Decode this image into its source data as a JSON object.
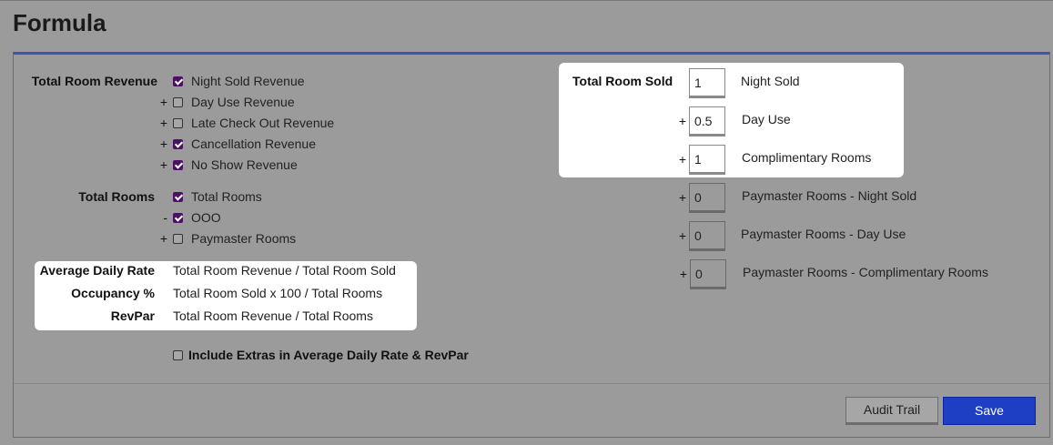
{
  "page_title": "Formula",
  "colors": {
    "accent": "#3856b4",
    "checkbox_checked": "#4b1263",
    "save_button": "#1e3fc4"
  },
  "total_room_revenue": {
    "label": "Total Room Revenue",
    "items": [
      {
        "op": "",
        "label": "Night Sold Revenue",
        "checked": true
      },
      {
        "op": "+",
        "label": "Day Use Revenue",
        "checked": false
      },
      {
        "op": "+",
        "label": "Late Check Out Revenue",
        "checked": false
      },
      {
        "op": "+",
        "label": "Cancellation Revenue",
        "checked": true
      },
      {
        "op": "+",
        "label": "No Show Revenue",
        "checked": true
      }
    ]
  },
  "total_rooms": {
    "label": "Total Rooms",
    "items": [
      {
        "op": "",
        "label": "Total Rooms",
        "checked": true
      },
      {
        "op": "-",
        "label": "OOO",
        "checked": true
      },
      {
        "op": "+",
        "label": "Paymaster Rooms",
        "checked": false
      }
    ]
  },
  "formulas": [
    {
      "label": "Average Daily Rate",
      "expression": "Total Room Revenue / Total Room Sold"
    },
    {
      "label": "Occupancy %",
      "expression": "Total Room Sold x 100 / Total Rooms"
    },
    {
      "label": "RevPar",
      "expression": "Total Room Revenue / Total Rooms"
    }
  ],
  "include_extras": {
    "label": "Include Extras in Average Daily Rate & RevPar",
    "checked": false
  },
  "total_room_sold": {
    "label": "Total Room Sold",
    "items": [
      {
        "op": "",
        "value": "1",
        "label": "Night Sold"
      },
      {
        "op": "+",
        "value": "0.5",
        "label": "Day Use"
      },
      {
        "op": "+",
        "value": "1",
        "label": "Complimentary Rooms"
      },
      {
        "op": "+",
        "value": "0",
        "label": "Paymaster Rooms - Night Sold"
      },
      {
        "op": "+",
        "value": "0",
        "label": "Paymaster Rooms - Day Use"
      },
      {
        "op": "+",
        "value": "0",
        "label": "Paymaster Rooms - Complimentary Rooms"
      }
    ]
  },
  "buttons": {
    "audit_trail": "Audit Trail",
    "save": "Save"
  }
}
